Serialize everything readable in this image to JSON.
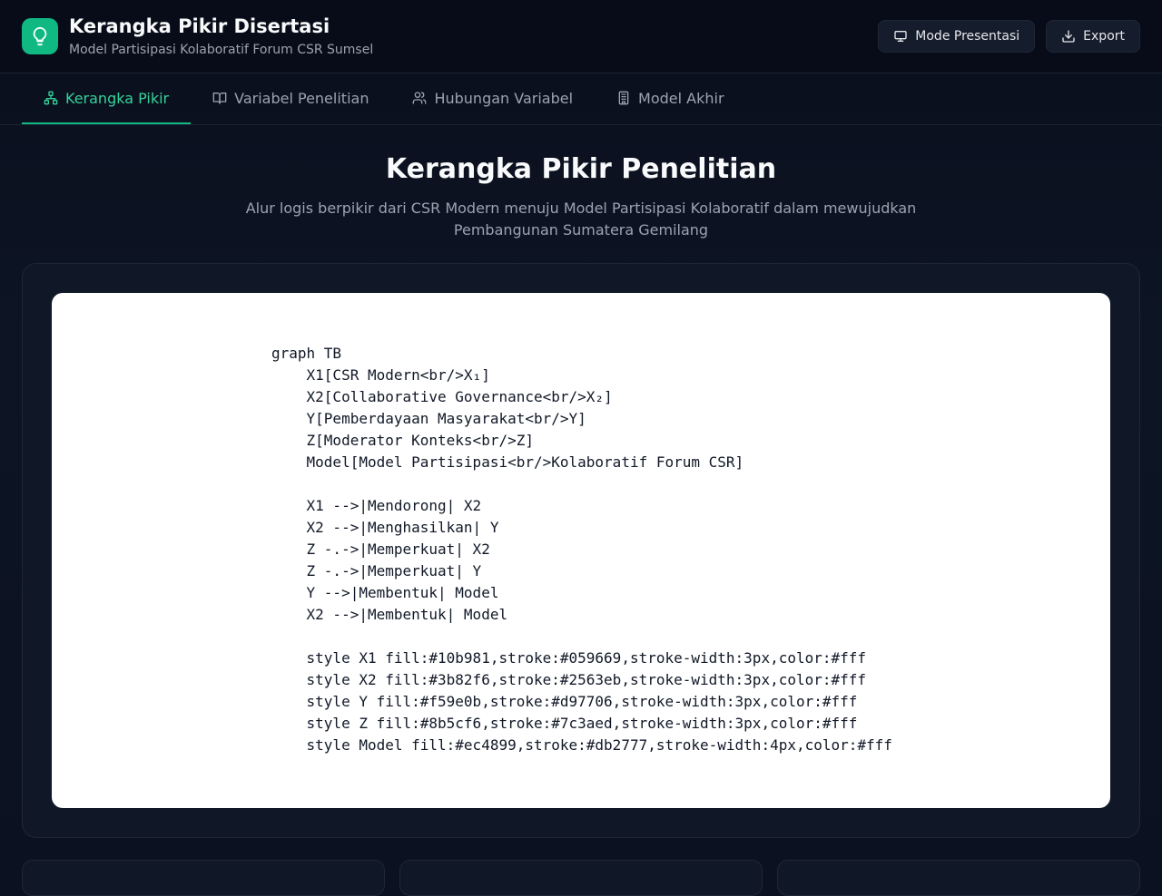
{
  "header": {
    "title": "Kerangka Pikir Disertasi",
    "subtitle": "Model Partisipasi Kolaboratif Forum CSR Sumsel",
    "logo_icon": "lightbulb-icon",
    "presentation_label": "Mode Presentasi",
    "export_label": "Export"
  },
  "tabs": [
    {
      "label": "Kerangka Pikir",
      "icon": "network-icon",
      "active": true
    },
    {
      "label": "Variabel Penelitian",
      "icon": "book-icon",
      "active": false
    },
    {
      "label": "Hubungan Variabel",
      "icon": "users-icon",
      "active": false
    },
    {
      "label": "Model Akhir",
      "icon": "building-icon",
      "active": false
    }
  ],
  "main": {
    "title": "Kerangka Pikir Penelitian",
    "description": "Alur logis berpikir dari CSR Modern menuju Model Partisipasi Kolaboratif dalam mewujudkan Pembangunan Sumatera Gemilang",
    "diagram_source": "graph TB\n    X1[CSR Modern<br/>X₁]\n    X2[Collaborative Governance<br/>X₂]\n    Y[Pemberdayaan Masyarakat<br/>Y]\n    Z[Moderator Konteks<br/>Z]\n    Model[Model Partisipasi<br/>Kolaboratif Forum CSR]\n\n    X1 -->|Mendorong| X2\n    X2 -->|Menghasilkan| Y\n    Z -.->|Memperkuat| X2\n    Z -.->|Memperkuat| Y\n    Y -->|Membentuk| Model\n    X2 -->|Membentuk| Model\n\n    style X1 fill:#10b981,stroke:#059669,stroke-width:3px,color:#fff\n    style X2 fill:#3b82f6,stroke:#2563eb,stroke-width:3px,color:#fff\n    style Y fill:#f59e0b,stroke:#d97706,stroke-width:3px,color:#fff\n    style Z fill:#8b5cf6,stroke:#7c3aed,stroke-width:3px,color:#fff\n    style Model fill:#ec4899,stroke:#db2777,stroke-width:4px,color:#fff"
  },
  "colors": {
    "accent": "#10b981",
    "accent_text": "#34d399",
    "background": "#0b1120"
  }
}
